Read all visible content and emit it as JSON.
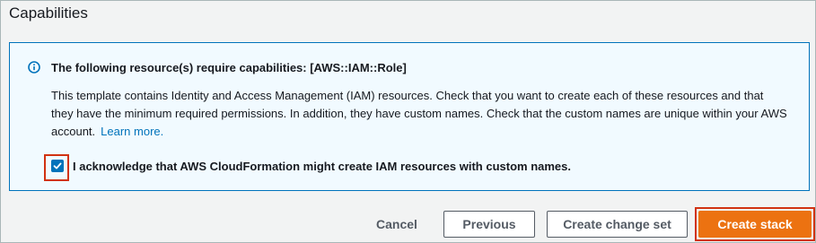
{
  "section": {
    "title": "Capabilities"
  },
  "info": {
    "heading": "The following resource(s) require capabilities: [AWS::IAM::Role]",
    "body": "This template contains Identity and Access Management (IAM) resources. Check that you want to create each of these resources and that they have the minimum required permissions. In addition, they have custom names. Check that the custom names are unique within your AWS account.",
    "link_label": "Learn more."
  },
  "acknowledge": {
    "label": "I acknowledge that AWS CloudFormation might create IAM resources with custom names.",
    "checked": true
  },
  "actions": {
    "cancel_label": "Cancel",
    "previous_label": "Previous",
    "change_set_label": "Create change set",
    "create_label": "Create stack"
  },
  "colors": {
    "accent": "#0073bb",
    "primary_button": "#ec7211",
    "highlight": "#d13212",
    "info_background": "#f1faff"
  },
  "icons": {
    "info": "info-circle-icon",
    "check": "checkmark-icon"
  }
}
